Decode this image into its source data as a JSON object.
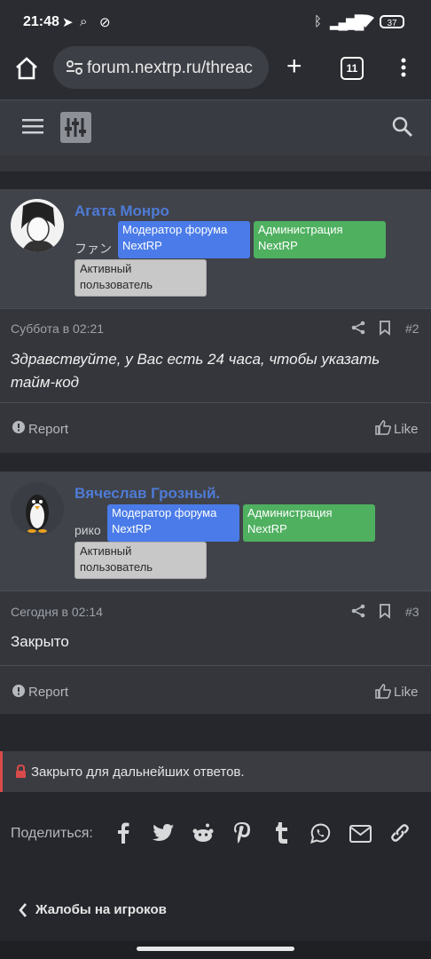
{
  "status": {
    "time": "21:48",
    "battery": "37"
  },
  "browser": {
    "url": "forum.nextrp.ru/threac",
    "tabs": "11"
  },
  "posts": [
    {
      "user": "Агата Монро",
      "title": "ファン",
      "badges": [
        "Модератор форума NextRP",
        "Администрация NextRP",
        "Активный пользователь"
      ],
      "date": "Суббота в 02:21",
      "num": "#2",
      "content": "Здравствуйте, у Вас есть 24 часа, чтобы указать тайм-код",
      "report": "Report",
      "like": "Like"
    },
    {
      "user": "Вячеслав Грозный.",
      "title": "рико",
      "badges": [
        "Модератор форума NextRP",
        "Администрация NextRP",
        "Активный пользователь"
      ],
      "date": "Сегодня в 02:14",
      "num": "#3",
      "content": "Закрыто",
      "report": "Report",
      "like": "Like"
    }
  ],
  "closed_notice": "Закрыто для дальнейших ответов.",
  "share_label": "Поделиться:",
  "share_icons": [
    "facebook-icon",
    "twitter-icon",
    "reddit-icon",
    "pinterest-icon",
    "tumblr-icon",
    "whatsapp-icon",
    "email-icon",
    "link-icon"
  ],
  "back_link": "Жалобы на игроков"
}
